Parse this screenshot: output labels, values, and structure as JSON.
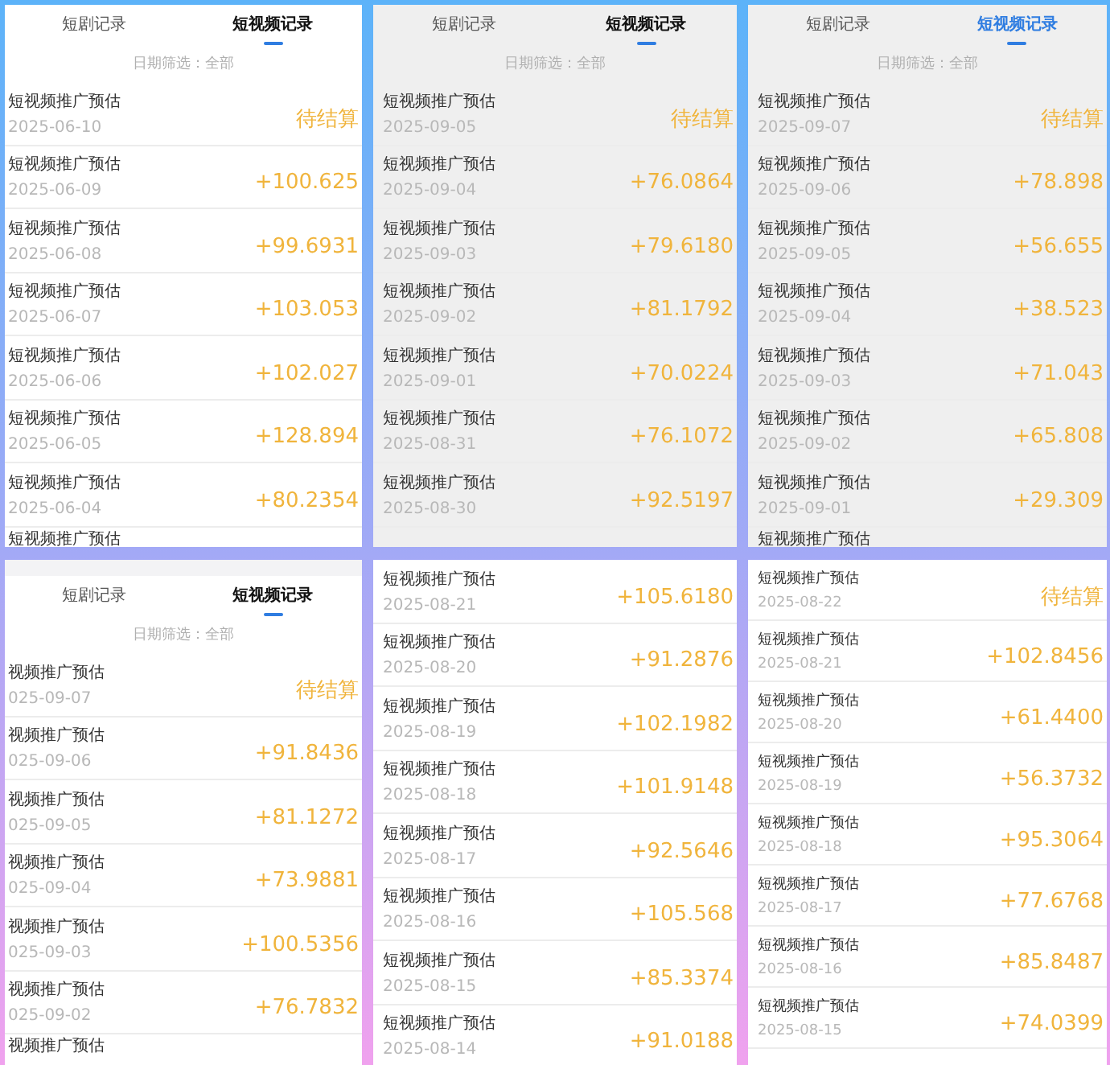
{
  "panels": [
    {
      "shaded": false,
      "tabs": [
        {
          "label": "短剧记录",
          "selected": false
        },
        {
          "label": "短视频记录",
          "selected": true
        }
      ],
      "filter": "日期筛选：全部",
      "records": [
        {
          "title": "短视频推广预估",
          "date": "2025-06-10",
          "amount": "待结算"
        },
        {
          "title": "短视频推广预估",
          "date": "2025-06-09",
          "amount": "+100.625"
        },
        {
          "title": "短视频推广预估",
          "date": "2025-06-08",
          "amount": "+99.6931"
        },
        {
          "title": "短视频推广预估",
          "date": "2025-06-07",
          "amount": "+103.053"
        },
        {
          "title": "短视频推广预估",
          "date": "2025-06-06",
          "amount": "+102.027"
        },
        {
          "title": "短视频推广预估",
          "date": "2025-06-05",
          "amount": "+128.894"
        },
        {
          "title": "短视频推广预估",
          "date": "2025-06-04",
          "amount": "+80.2354"
        },
        {
          "title": "短视频推广预估"
        }
      ]
    },
    {
      "shaded": true,
      "tabs": [
        {
          "label": "短剧记录",
          "selected": false
        },
        {
          "label": "短视频记录",
          "selected": true
        }
      ],
      "filter": "日期筛选：全部",
      "records": [
        {
          "title": "短视频推广预估",
          "date": "2025-09-05",
          "amount": "待结算"
        },
        {
          "title": "短视频推广预估",
          "date": "2025-09-04",
          "amount": "+76.0864"
        },
        {
          "title": "短视频推广预估",
          "date": "2025-09-03",
          "amount": "+79.6180"
        },
        {
          "title": "短视频推广预估",
          "date": "2025-09-02",
          "amount": "+81.1792"
        },
        {
          "title": "短视频推广预估",
          "date": "2025-09-01",
          "amount": "+70.0224"
        },
        {
          "title": "短视频推广预估",
          "date": "2025-08-31",
          "amount": "+76.1072"
        },
        {
          "title": "短视频推广预估",
          "date": "2025-08-30",
          "amount": "+92.5197"
        }
      ]
    },
    {
      "shaded": true,
      "tabs": [
        {
          "label": "短剧记录",
          "selected": false
        },
        {
          "label": "短视频记录",
          "selected": true
        }
      ],
      "filter": "日期筛选：全部",
      "records": [
        {
          "title": "短视频推广预估",
          "date": "2025-09-07",
          "amount": "待结算"
        },
        {
          "title": "短视频推广预估",
          "date": "2025-09-06",
          "amount": "+78.898"
        },
        {
          "title": "短视频推广预估",
          "date": "2025-09-05",
          "amount": "+56.655"
        },
        {
          "title": "短视频推广预估",
          "date": "2025-09-04",
          "amount": "+38.523"
        },
        {
          "title": "短视频推广预估",
          "date": "2025-09-03",
          "amount": "+71.043"
        },
        {
          "title": "短视频推广预估",
          "date": "2025-09-02",
          "amount": "+65.808"
        },
        {
          "title": "短视频推广预估",
          "date": "2025-09-01",
          "amount": "+29.309"
        },
        {
          "title": "短视频推广预估"
        }
      ]
    },
    {
      "shaded": false,
      "tabs": [
        {
          "label": "短剧记录",
          "selected": false
        },
        {
          "label": "短视频记录",
          "selected": true
        }
      ],
      "filter": "日期筛选：全部",
      "records": [
        {
          "title": "视频推广预估",
          "date": "025-09-07",
          "amount": "待结算"
        },
        {
          "title": "视频推广预估",
          "date": "025-09-06",
          "amount": "+91.8436"
        },
        {
          "title": "视频推广预估",
          "date": "025-09-05",
          "amount": "+81.1272"
        },
        {
          "title": "视频推广预估",
          "date": "025-09-04",
          "amount": "+73.9881"
        },
        {
          "title": "视频推广预估",
          "date": "025-09-03",
          "amount": "+100.5356"
        },
        {
          "title": "视频推广预估",
          "date": "025-09-02",
          "amount": "+76.7832"
        },
        {
          "title": "视频推广预估"
        }
      ]
    },
    {
      "shaded": false,
      "records": [
        {
          "title": "短视频推广预估",
          "date": "2025-08-21",
          "amount": "+105.6180"
        },
        {
          "title": "短视频推广预估",
          "date": "2025-08-20",
          "amount": "+91.2876"
        },
        {
          "title": "短视频推广预估",
          "date": "2025-08-19",
          "amount": "+102.1982"
        },
        {
          "title": "短视频推广预估",
          "date": "2025-08-18",
          "amount": "+101.9148"
        },
        {
          "title": "短视频推广预估",
          "date": "2025-08-17",
          "amount": "+92.5646"
        },
        {
          "title": "短视频推广预估",
          "date": "2025-08-16",
          "amount": "+105.568"
        },
        {
          "title": "短视频推广预估",
          "date": "2025-08-15",
          "amount": "+85.3374"
        },
        {
          "title": "短视频推广预估",
          "date": "2025-08-14",
          "amount": "+91.0188"
        }
      ]
    },
    {
      "shaded": false,
      "records": [
        {
          "title": "短视频推广预估",
          "date": "2025-08-22",
          "amount": "待结算"
        },
        {
          "title": "短视频推广预估",
          "date": "2025-08-21",
          "amount": "+102.8456"
        },
        {
          "title": "短视频推广预估",
          "date": "2025-08-20",
          "amount": "+61.4400"
        },
        {
          "title": "短视频推广预估",
          "date": "2025-08-19",
          "amount": "+56.3732"
        },
        {
          "title": "短视频推广预估",
          "date": "2025-08-18",
          "amount": "+95.3064"
        },
        {
          "title": "短视频推广预估",
          "date": "2025-08-17",
          "amount": "+77.6768"
        },
        {
          "title": "短视频推广预估",
          "date": "2025-08-16",
          "amount": "+85.8487"
        },
        {
          "title": "短视频推广预估",
          "date": "2025-08-15",
          "amount": "+74.0399"
        }
      ]
    }
  ]
}
